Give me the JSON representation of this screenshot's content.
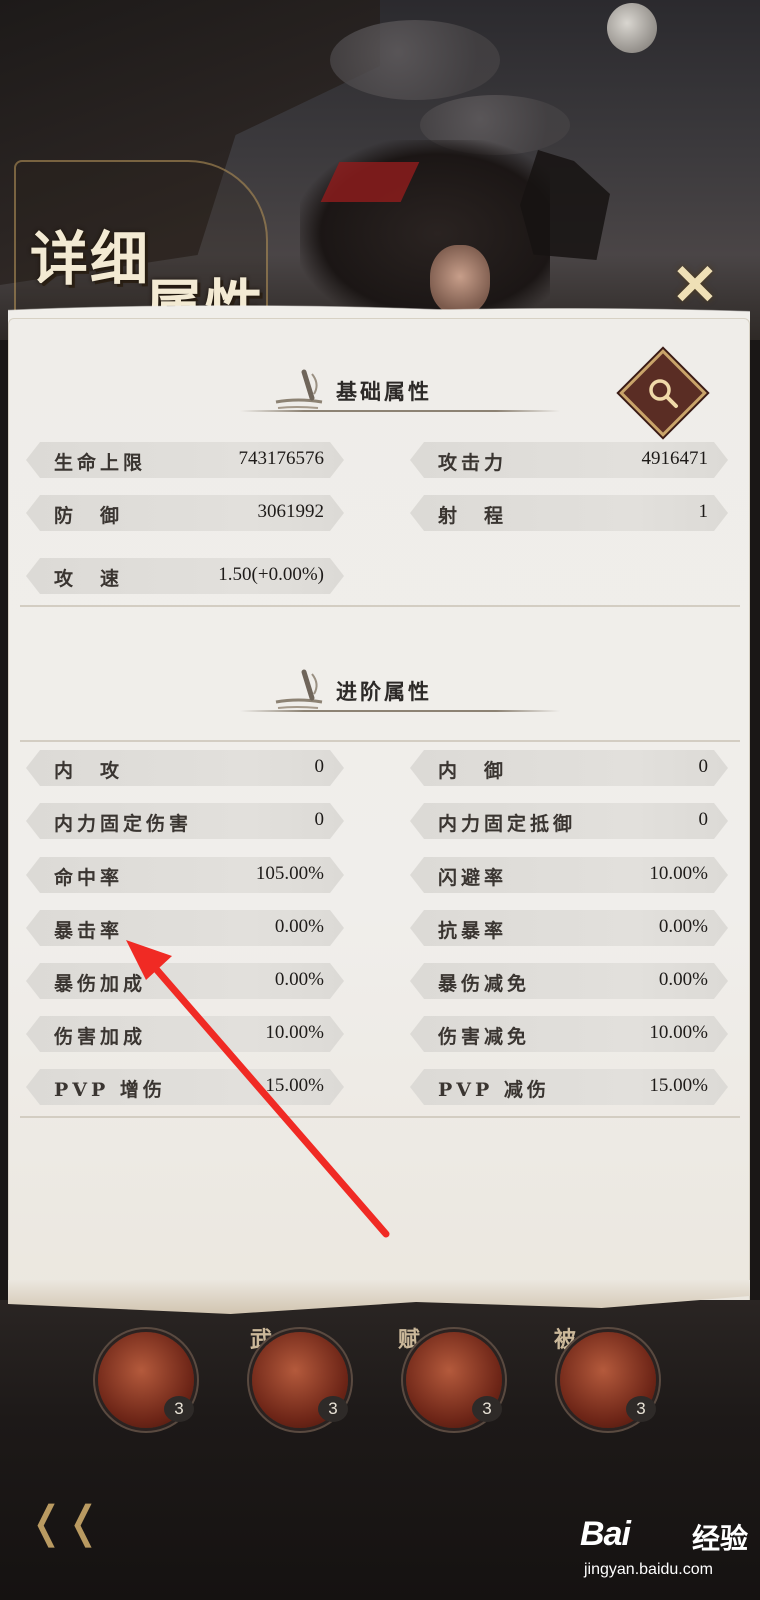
{
  "header": {
    "title_line1": "详细",
    "title_line2": "属性",
    "close_label": "✕"
  },
  "basic": {
    "title": "基础属性",
    "stats": [
      {
        "label": "生命上限",
        "value": "743176576"
      },
      {
        "label": "攻击力",
        "value": "4916471"
      },
      {
        "label": "防　御",
        "value": "3061992"
      },
      {
        "label": "射　程",
        "value": "1"
      },
      {
        "label": "攻　速",
        "value": "1.50(+0.00%)"
      }
    ]
  },
  "advanced": {
    "title": "进阶属性",
    "stats": [
      {
        "label": "内　攻",
        "value": "0"
      },
      {
        "label": "内　御",
        "value": "0"
      },
      {
        "label": "内力固定伤害",
        "value": "0"
      },
      {
        "label": "内力固定抵御",
        "value": "0"
      },
      {
        "label": "命中率",
        "value": "105.00%"
      },
      {
        "label": "闪避率",
        "value": "10.00%"
      },
      {
        "label": "暴击率",
        "value": "0.00%"
      },
      {
        "label": "抗暴率",
        "value": "0.00%"
      },
      {
        "label": "暴伤加成",
        "value": "0.00%"
      },
      {
        "label": "暴伤减免",
        "value": "0.00%"
      },
      {
        "label": "伤害加成",
        "value": "10.00%"
      },
      {
        "label": "伤害减免",
        "value": "10.00%"
      },
      {
        "label": "PVP 增伤",
        "value": "15.00%"
      },
      {
        "label": "PVP 减伤",
        "value": "15.00%"
      }
    ]
  },
  "skills": [
    {
      "tag": "",
      "level": "3"
    },
    {
      "tag": "武",
      "level": "3"
    },
    {
      "tag": "赋",
      "level": "3"
    },
    {
      "tag": "被",
      "level": "3"
    }
  ],
  "watermark": {
    "brand": "Bai",
    "brand2": "经验",
    "url": "jingyan.baidu.com"
  },
  "colors": {
    "annotation_arrow": "#f02a24",
    "search_button": "#5a2d24",
    "panel_bg": "#efede9"
  },
  "icons": {
    "close": "close-icon",
    "search": "magnifier-icon",
    "back": "back-arrow-icon"
  }
}
